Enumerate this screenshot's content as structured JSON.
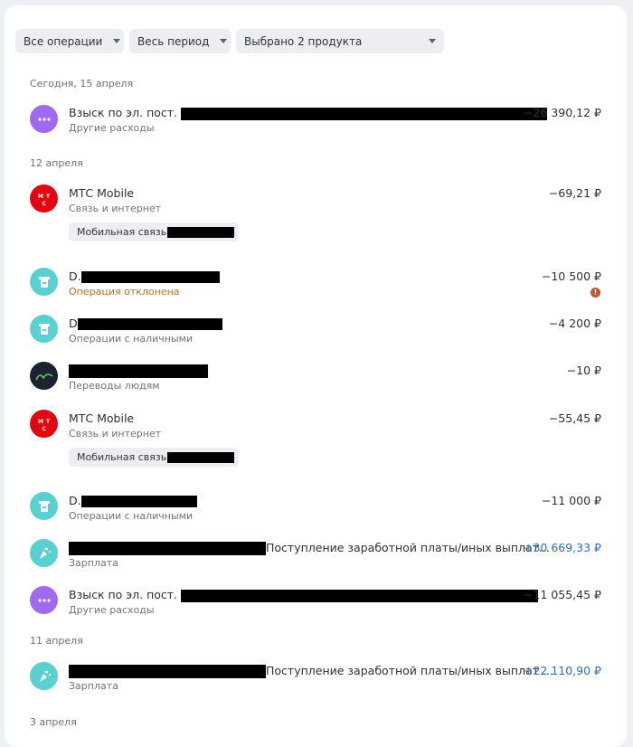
{
  "colors": {
    "purple": "#a06af0",
    "teal": "#5ad0d0",
    "mts_red": "#e30611",
    "dark": "#1c2230",
    "positive": "#2a6fbf",
    "error": "#c46a23"
  },
  "filters": {
    "operations": "Все операции",
    "period": "Весь период",
    "products": "Выбрано 2 продукта"
  },
  "groups": [
    {
      "date": "Сегодня, 15 апреля",
      "items": [
        {
          "title": "Взыск по эл. пост.",
          "subtitle": "Другие расходы",
          "amount": "−26 390,12 ₽",
          "icon": "more-icon"
        }
      ]
    },
    {
      "date": "12 апреля",
      "items": [
        {
          "title": "МТС Mobile",
          "subtitle": "Связь и интернет",
          "amount": "−69,21 ₽",
          "tag": "Мобильная связь",
          "icon": "mts-logo"
        },
        {
          "title": "D.",
          "subtitle": "Операция отклонена",
          "amount": "−10 500 ₽",
          "icon": "atm-icon",
          "warning": "!"
        },
        {
          "title": "D",
          "subtitle": "Операции с наличными",
          "amount": "−4 200 ₽",
          "icon": "atm-icon"
        },
        {
          "title": "",
          "subtitle": "Переводы людям",
          "amount": "−10 ₽",
          "icon": "bank-logo"
        },
        {
          "title": "МТС Mobile",
          "subtitle": "Связь и интернет",
          "amount": "−55,45 ₽",
          "tag": "Мобильная связь",
          "icon": "mts-logo"
        },
        {
          "title": "D.",
          "subtitle": "Операции с наличными",
          "amount": "−11 000 ₽",
          "icon": "atm-icon"
        },
        {
          "title": "Поступление заработной платы/иных выплат...",
          "subtitle": "Зарплата",
          "amount": "+30 669,33 ₽",
          "icon": "party-icon"
        },
        {
          "title": "Взыск по эл. пост.",
          "subtitle": "Другие расходы",
          "amount": "−11 055,45 ₽",
          "icon": "more-icon"
        }
      ]
    },
    {
      "date": "11 апреля",
      "items": [
        {
          "title": "Поступление заработной платы/иных выплат ...",
          "subtitle": "Зарплата",
          "amount": "+22 110,90 ₽",
          "icon": "party-icon"
        }
      ]
    },
    {
      "date": "3 апреля",
      "items": []
    }
  ]
}
